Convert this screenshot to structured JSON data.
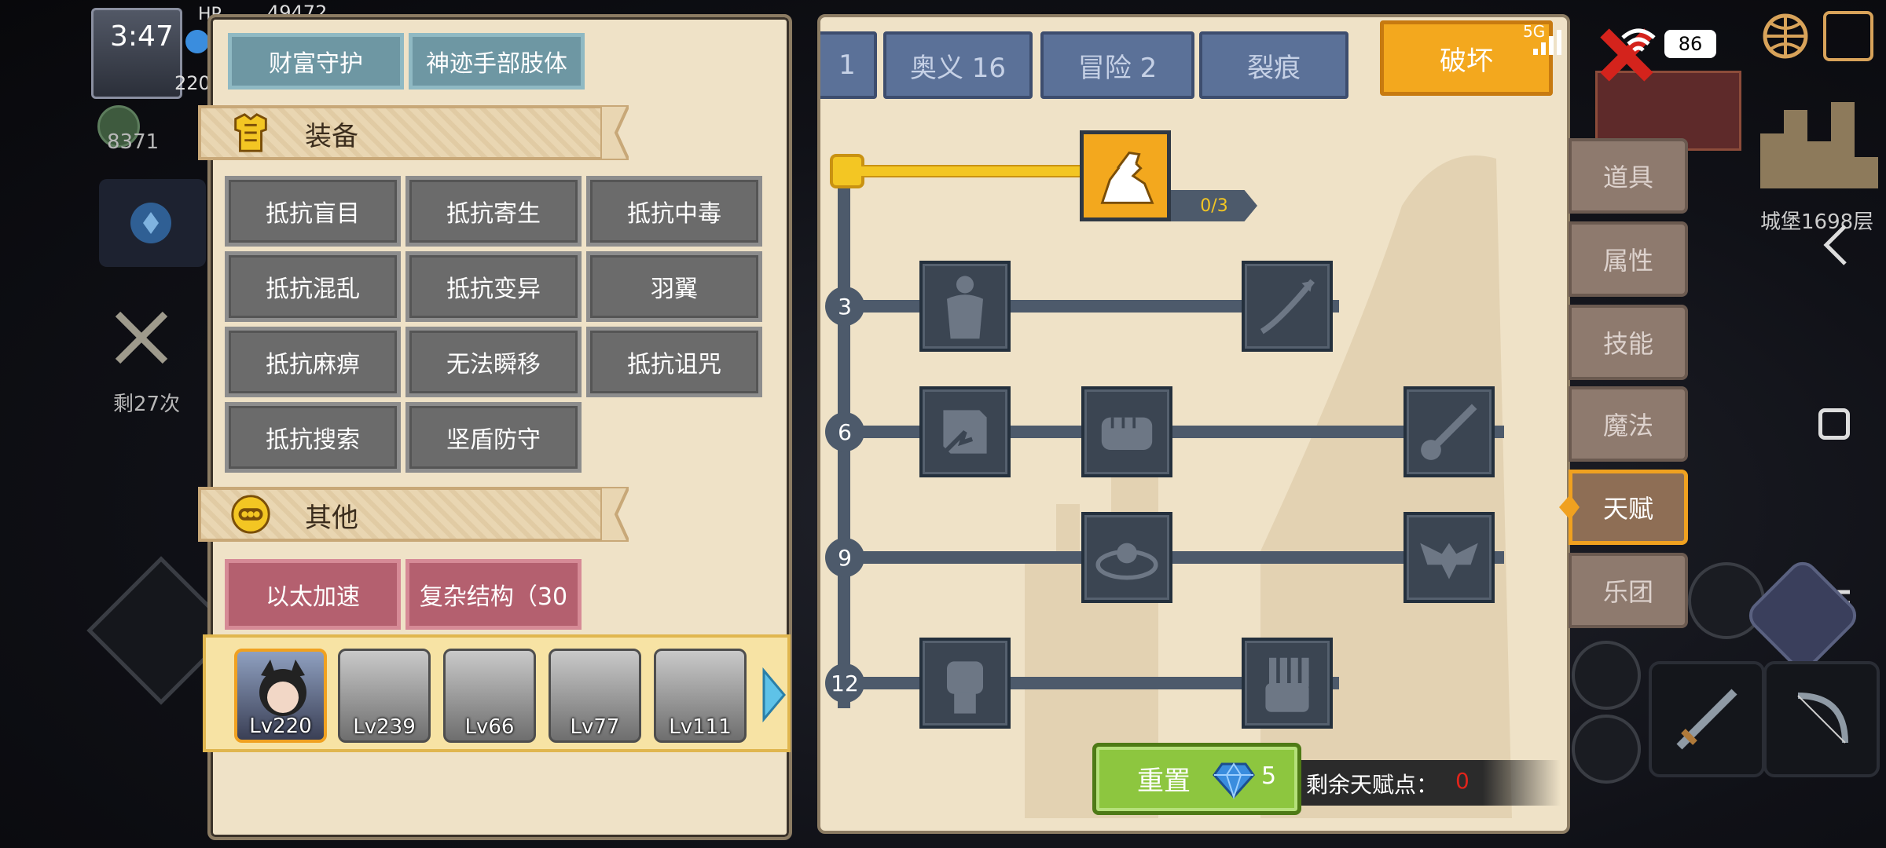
{
  "status_bar": {
    "time": "3:47",
    "battery": "86",
    "network": "5G"
  },
  "background": {
    "hp_label": "HP",
    "hp_value": "49472",
    "player_level": "220",
    "score": "8371",
    "remaining": "剩27次",
    "castle_floor": "城堡1698层"
  },
  "left_panel": {
    "top_buttons": [
      "财富守护",
      "神迹手部肢体"
    ],
    "equipment_title": "装备",
    "equipment_buttons": [
      "抵抗盲目",
      "抵抗寄生",
      "抵抗中毒",
      "抵抗混乱",
      "抵抗变异",
      "羽翼",
      "抵抗麻痹",
      "无法瞬移",
      "抵抗诅咒",
      "抵抗搜索",
      "坚盾防守"
    ],
    "other_title": "其他",
    "other_buttons": [
      "以太加速",
      "复杂结构（30"
    ],
    "characters": [
      {
        "level": "Lv220",
        "selected": true
      },
      {
        "level": "Lv239",
        "selected": false
      },
      {
        "level": "Lv66",
        "selected": false
      },
      {
        "level": "Lv77",
        "selected": false
      },
      {
        "level": "Lv111",
        "selected": false
      }
    ]
  },
  "tree_panel": {
    "tabs": [
      {
        "label": "1",
        "active": false
      },
      {
        "label": "奥义 16",
        "active": false
      },
      {
        "label": "冒险 2",
        "active": false
      },
      {
        "label": "裂痕",
        "active": false
      },
      {
        "label": "破坏",
        "active": true
      }
    ],
    "top_node_progress": "0/3",
    "levels": [
      "3",
      "6",
      "9",
      "12"
    ],
    "reset_label": "重置",
    "reset_cost": "5",
    "points_label": "剩余天赋点：",
    "points_value": "0"
  },
  "side_menu": {
    "items": [
      {
        "label": "道具",
        "active": false
      },
      {
        "label": "属性",
        "active": false
      },
      {
        "label": "技能",
        "active": false
      },
      {
        "label": "魔法",
        "active": false
      },
      {
        "label": "天赋",
        "active": true
      },
      {
        "label": "乐团",
        "active": false
      }
    ]
  },
  "colors": {
    "accent_orange": "#f3a81e",
    "panel_bg": "#efe2c7",
    "tab_blue": "#5b7198",
    "reset_green": "#8dc63f",
    "points_red": "#e0241b"
  },
  "icons": [
    "armwrestle-icon",
    "body-icon",
    "arrow-icon",
    "shield-break-icon",
    "fist-icon",
    "splash-icon",
    "ripple-icon",
    "bat-icon",
    "raised-fist-icon",
    "grip-icon",
    "diamond-icon",
    "close-icon",
    "wifi-icon",
    "battery-icon",
    "back-icon",
    "square-icon",
    "menu-icon"
  ]
}
